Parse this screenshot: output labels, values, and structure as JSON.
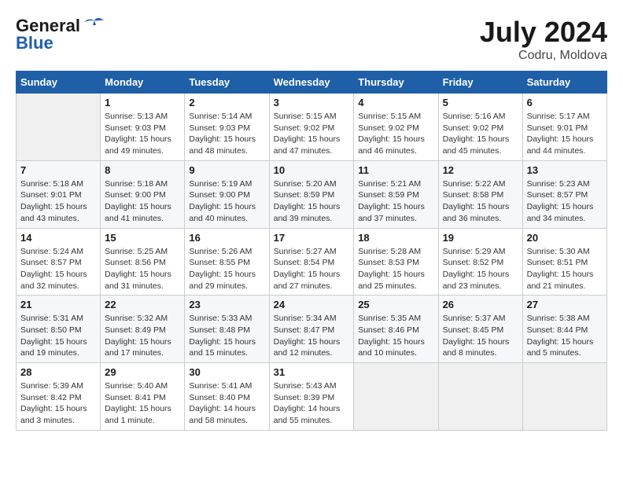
{
  "header": {
    "logo_general": "General",
    "logo_blue": "Blue",
    "month_year": "July 2024",
    "location": "Codru, Moldova"
  },
  "weekdays": [
    "Sunday",
    "Monday",
    "Tuesday",
    "Wednesday",
    "Thursday",
    "Friday",
    "Saturday"
  ],
  "weeks": [
    [
      {
        "day": "",
        "empty": true
      },
      {
        "day": "1",
        "sunrise": "5:13 AM",
        "sunset": "9:03 PM",
        "daylight": "15 hours and 49 minutes."
      },
      {
        "day": "2",
        "sunrise": "5:14 AM",
        "sunset": "9:03 PM",
        "daylight": "15 hours and 48 minutes."
      },
      {
        "day": "3",
        "sunrise": "5:15 AM",
        "sunset": "9:02 PM",
        "daylight": "15 hours and 47 minutes."
      },
      {
        "day": "4",
        "sunrise": "5:15 AM",
        "sunset": "9:02 PM",
        "daylight": "15 hours and 46 minutes."
      },
      {
        "day": "5",
        "sunrise": "5:16 AM",
        "sunset": "9:02 PM",
        "daylight": "15 hours and 45 minutes."
      },
      {
        "day": "6",
        "sunrise": "5:17 AM",
        "sunset": "9:01 PM",
        "daylight": "15 hours and 44 minutes."
      }
    ],
    [
      {
        "day": "7",
        "sunrise": "5:18 AM",
        "sunset": "9:01 PM",
        "daylight": "15 hours and 43 minutes."
      },
      {
        "day": "8",
        "sunrise": "5:18 AM",
        "sunset": "9:00 PM",
        "daylight": "15 hours and 41 minutes."
      },
      {
        "day": "9",
        "sunrise": "5:19 AM",
        "sunset": "9:00 PM",
        "daylight": "15 hours and 40 minutes."
      },
      {
        "day": "10",
        "sunrise": "5:20 AM",
        "sunset": "8:59 PM",
        "daylight": "15 hours and 39 minutes."
      },
      {
        "day": "11",
        "sunrise": "5:21 AM",
        "sunset": "8:59 PM",
        "daylight": "15 hours and 37 minutes."
      },
      {
        "day": "12",
        "sunrise": "5:22 AM",
        "sunset": "8:58 PM",
        "daylight": "15 hours and 36 minutes."
      },
      {
        "day": "13",
        "sunrise": "5:23 AM",
        "sunset": "8:57 PM",
        "daylight": "15 hours and 34 minutes."
      }
    ],
    [
      {
        "day": "14",
        "sunrise": "5:24 AM",
        "sunset": "8:57 PM",
        "daylight": "15 hours and 32 minutes."
      },
      {
        "day": "15",
        "sunrise": "5:25 AM",
        "sunset": "8:56 PM",
        "daylight": "15 hours and 31 minutes."
      },
      {
        "day": "16",
        "sunrise": "5:26 AM",
        "sunset": "8:55 PM",
        "daylight": "15 hours and 29 minutes."
      },
      {
        "day": "17",
        "sunrise": "5:27 AM",
        "sunset": "8:54 PM",
        "daylight": "15 hours and 27 minutes."
      },
      {
        "day": "18",
        "sunrise": "5:28 AM",
        "sunset": "8:53 PM",
        "daylight": "15 hours and 25 minutes."
      },
      {
        "day": "19",
        "sunrise": "5:29 AM",
        "sunset": "8:52 PM",
        "daylight": "15 hours and 23 minutes."
      },
      {
        "day": "20",
        "sunrise": "5:30 AM",
        "sunset": "8:51 PM",
        "daylight": "15 hours and 21 minutes."
      }
    ],
    [
      {
        "day": "21",
        "sunrise": "5:31 AM",
        "sunset": "8:50 PM",
        "daylight": "15 hours and 19 minutes."
      },
      {
        "day": "22",
        "sunrise": "5:32 AM",
        "sunset": "8:49 PM",
        "daylight": "15 hours and 17 minutes."
      },
      {
        "day": "23",
        "sunrise": "5:33 AM",
        "sunset": "8:48 PM",
        "daylight": "15 hours and 15 minutes."
      },
      {
        "day": "24",
        "sunrise": "5:34 AM",
        "sunset": "8:47 PM",
        "daylight": "15 hours and 12 minutes."
      },
      {
        "day": "25",
        "sunrise": "5:35 AM",
        "sunset": "8:46 PM",
        "daylight": "15 hours and 10 minutes."
      },
      {
        "day": "26",
        "sunrise": "5:37 AM",
        "sunset": "8:45 PM",
        "daylight": "15 hours and 8 minutes."
      },
      {
        "day": "27",
        "sunrise": "5:38 AM",
        "sunset": "8:44 PM",
        "daylight": "15 hours and 5 minutes."
      }
    ],
    [
      {
        "day": "28",
        "sunrise": "5:39 AM",
        "sunset": "8:42 PM",
        "daylight": "15 hours and 3 minutes."
      },
      {
        "day": "29",
        "sunrise": "5:40 AM",
        "sunset": "8:41 PM",
        "daylight": "15 hours and 1 minute."
      },
      {
        "day": "30",
        "sunrise": "5:41 AM",
        "sunset": "8:40 PM",
        "daylight": "14 hours and 58 minutes."
      },
      {
        "day": "31",
        "sunrise": "5:43 AM",
        "sunset": "8:39 PM",
        "daylight": "14 hours and 55 minutes."
      },
      {
        "day": "",
        "empty": true
      },
      {
        "day": "",
        "empty": true
      },
      {
        "day": "",
        "empty": true
      }
    ]
  ],
  "labels": {
    "sunrise_prefix": "Sunrise: ",
    "sunset_prefix": "Sunset: ",
    "daylight_prefix": "Daylight: "
  }
}
